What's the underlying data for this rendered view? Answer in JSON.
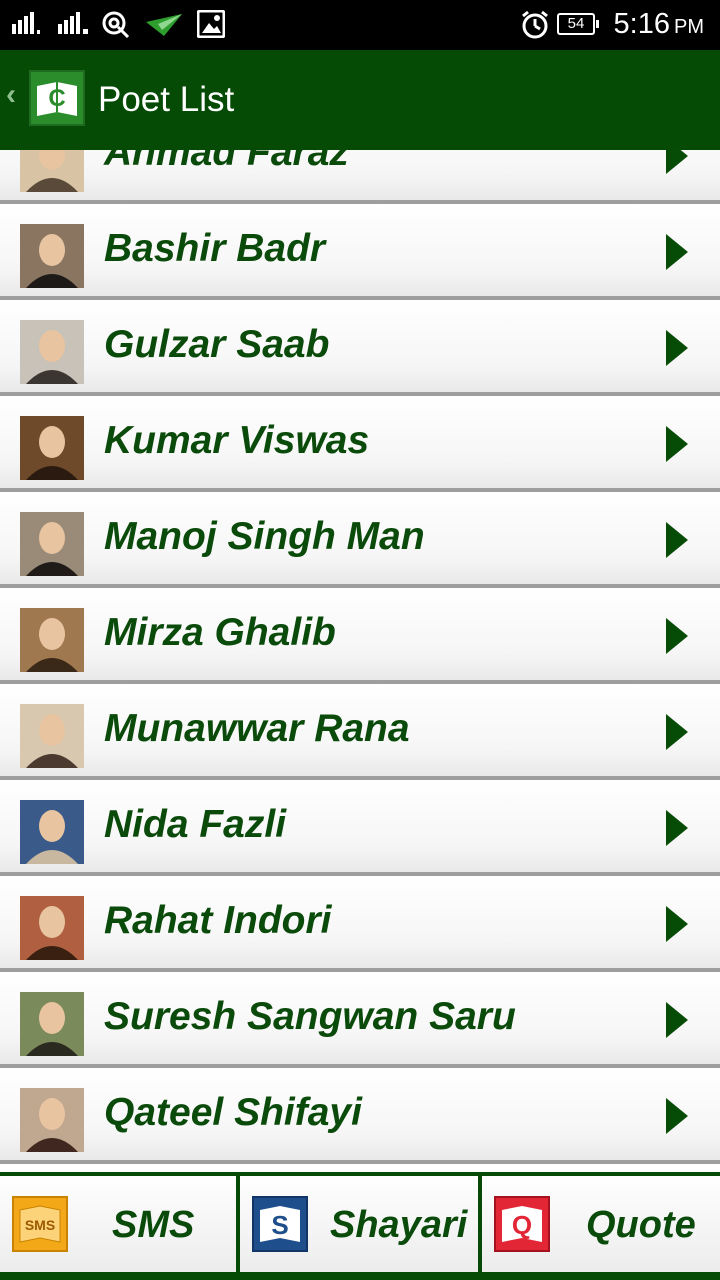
{
  "status_bar": {
    "time": "5:16",
    "ampm": "PM",
    "battery": "54",
    "icons": [
      "signal-1-icon",
      "signal-2-icon",
      "hotspot-icon",
      "send-icon",
      "image-icon",
      "alarm-icon",
      "battery-icon"
    ]
  },
  "app_bar": {
    "title": "Poet List",
    "back_icon": "chevron-left-icon",
    "logo_icon": "book-logo-icon",
    "logo_letter": "C",
    "color": "#054a05"
  },
  "poets": [
    {
      "name": "Ahmad Faraz",
      "avatar": "portrait-icon"
    },
    {
      "name": "Bashir Badr",
      "avatar": "portrait-icon"
    },
    {
      "name": "Gulzar Saab",
      "avatar": "portrait-icon"
    },
    {
      "name": "Kumar Viswas",
      "avatar": "portrait-icon"
    },
    {
      "name": "Manoj Singh Man",
      "avatar": "portrait-icon"
    },
    {
      "name": "Mirza Ghalib",
      "avatar": "portrait-icon"
    },
    {
      "name": "Munawwar Rana",
      "avatar": "portrait-icon"
    },
    {
      "name": "Nida Fazli",
      "avatar": "portrait-icon"
    },
    {
      "name": "Rahat Indori",
      "avatar": "portrait-icon"
    },
    {
      "name": "Suresh Sangwan Saru",
      "avatar": "portrait-icon"
    },
    {
      "name": "Qateel Shifayi",
      "avatar": "portrait-icon"
    }
  ],
  "bottom_tabs": [
    {
      "label": "SMS",
      "icon": "sms-book-icon",
      "icon_text": "SMS",
      "color": "#f2a817"
    },
    {
      "label": "Shayari",
      "icon": "shayari-book-icon",
      "icon_text": "S",
      "color": "#1e4e8c"
    },
    {
      "label": "Quote",
      "icon": "quote-book-icon",
      "icon_text": "Q",
      "color": "#e32636"
    }
  ]
}
